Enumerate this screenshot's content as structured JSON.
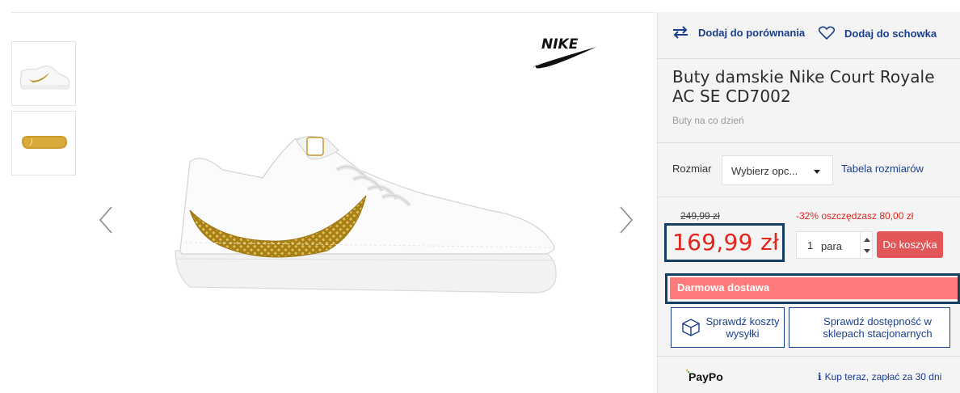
{
  "product": {
    "title": "Buty damskie Nike Court Royale AC SE CD7002",
    "category": "Buty na co dzień",
    "brand_logo": "nike-logo"
  },
  "actions": {
    "compare_label": "Dodaj do porównania",
    "wishlist_label": "Dodaj do schowka"
  },
  "size": {
    "label": "Rozmiar",
    "select_value": "Wybierz opc...",
    "table_link": "Tabela rozmiarów"
  },
  "pricing": {
    "old_price": "249,99 zł",
    "savings": "-32% oszczędzasz 80,00 zł",
    "price": "169,99 zł",
    "price_color": "#e1251b"
  },
  "quantity": {
    "value": "1",
    "unit": "para"
  },
  "cart": {
    "button_label": "Do koszyka",
    "button_color": "#e25658"
  },
  "shipping": {
    "free_label": "Darmowa dostawa",
    "check_cost_label": "Sprawdź koszty wysyłki",
    "check_stores_label": "Sprawdź dostępność w sklepach stacjonarnych"
  },
  "paypo": {
    "logo": "PayPo",
    "info": "Kup teraz, zapłać za 30 dni"
  },
  "gallery": {
    "thumbnails": [
      "shoe-side-view",
      "shoe-sole-view"
    ],
    "prev_icon": "chevron-left-icon",
    "next_icon": "chevron-right-icon"
  },
  "colors": {
    "accent_blue": "#1a3e8c",
    "highlight_border": "#163e63",
    "shipping_bar": "#ff7b7b",
    "gold": "#b8901e"
  }
}
